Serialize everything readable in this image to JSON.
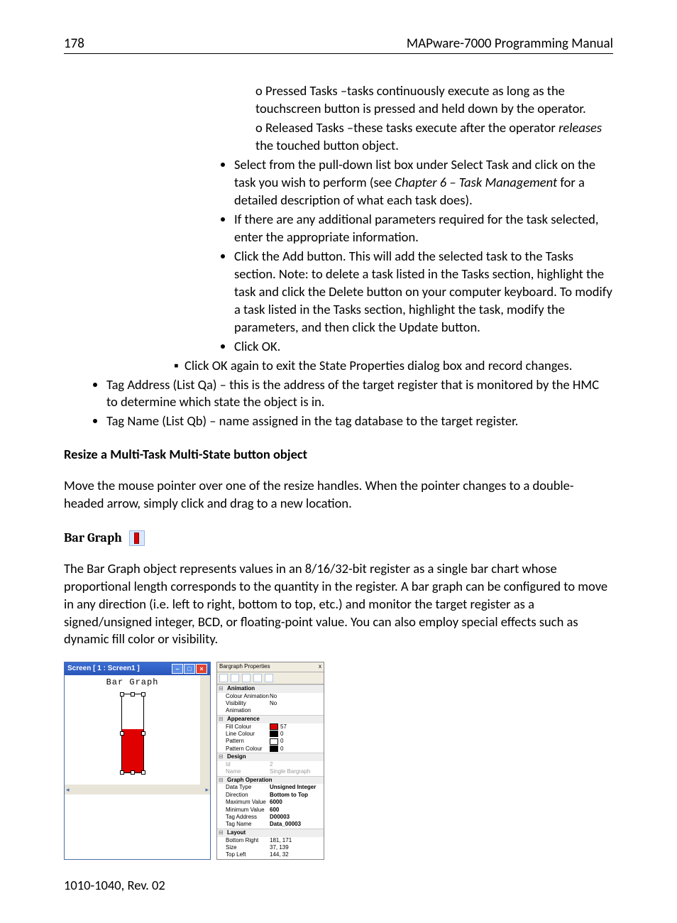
{
  "header": {
    "pagenum": "178",
    "title": "MAPware-7000 Programming Manual"
  },
  "list": {
    "l4a": "Pressed Tasks –tasks continuously execute as long as the touchscreen button is pressed and held down by the operator.",
    "l4b_pre": "Released Tasks –these tasks execute after the operator ",
    "l4b_it": "releases",
    "l4b_post": " the touched button object.",
    "l3a_pre": "Select from the pull-down list box under Select Task and click on the task you wish to perform (see ",
    "l3a_it": "Chapter 6 – Task Management",
    "l3a_post": " for a detailed description of what each task does).",
    "l3b": "If there are any additional parameters required for the task selected, enter the appropriate information.",
    "l3c": "Click the Add button.  This will add the selected task to the Tasks section. Note: to delete a task listed in the Tasks section, highlight the task and click the Delete button on your computer keyboard.  To modify a task listed in the Tasks section, highlight the task, modify the parameters, and then click the Update button.",
    "l3d": "Click OK.",
    "l2a": "Click OK again to exit the State Properties dialog box and record changes.",
    "l1a": "Tag Address (List Qa) – this is the address of the target register that is monitored by the HMC to determine which state the object is in.",
    "l1b": "Tag Name (List Qb) – name assigned in the tag database to the target register."
  },
  "resize_heading": "Resize a Multi-Task Multi-State button object",
  "resize_body": "Move the mouse pointer over one of the resize handles.  When the pointer changes to a double-headed arrow, simply click and drag to a new location.",
  "bargraph_heading": "Bar Graph",
  "bargraph_body": "The Bar Graph object represents values in an 8/16/32-bit register as a single bar chart whose proportional length corresponds to the quantity in the register.  A bar graph can be configured to move in any direction (i.e. left to right, bottom to top, etc.) and monitor the target register as a signed/unsigned integer, BCD, or floating-point value.  You can also employ special effects such as dynamic fill color or visibility.",
  "win": {
    "title": "Screen  [ 1  :  Screen1 ]",
    "label": "Bar Graph"
  },
  "props": {
    "title": "Bargraph Properties",
    "close": "x",
    "cats": {
      "animation": "Animation",
      "appearance": "Appearence",
      "design": "Design",
      "graphop": "Graph Operation",
      "layout": "Layout"
    },
    "rows": {
      "colanim_k": "Colour Animation",
      "colanim_v": "No",
      "visanim_k": "Visibility Animation",
      "visanim_v": "No",
      "fillcol_k": "Fill Colour",
      "fillcol_v": "57",
      "linecol_k": "Line Colour",
      "linecol_v": "0",
      "pattern_k": "Pattern",
      "pattern_v": "0",
      "patcol_k": "Pattern Colour",
      "patcol_v": "0",
      "id_k": "Id",
      "id_v": "2",
      "name_k": "Name",
      "name_v": "Single Bargraph",
      "dtype_k": "Data Type",
      "dtype_v": "Unsigned Integer",
      "dir_k": "Direction",
      "dir_v": "Bottom to Top",
      "maxv_k": "Maximum Value",
      "maxv_v": "6000",
      "minv_k": "Minimum Value",
      "minv_v": "600",
      "tagaddr_k": "Tag Address",
      "tagaddr_v": "D00003",
      "tagname_k": "Tag Name",
      "tagname_v": "Data_00003",
      "br_k": "Bottom Right",
      "br_v": "181, 171",
      "size_k": "Size",
      "size_v": "37, 139",
      "tl_k": "Top Left",
      "tl_v": "144, 32"
    }
  },
  "footer": "1010-1040, Rev. 02"
}
